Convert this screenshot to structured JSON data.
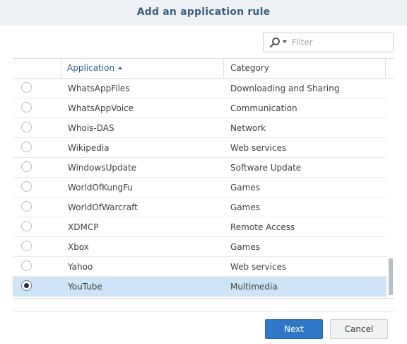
{
  "dialog": {
    "title": "Add an application rule"
  },
  "filter": {
    "placeholder": "Filter",
    "value": ""
  },
  "table": {
    "columns": {
      "application": "Application",
      "category": "Category",
      "sort_direction": "ascending"
    },
    "rows": [
      {
        "application": "WhatsAppFiles",
        "category": "Downloading and Sharing",
        "selected": false
      },
      {
        "application": "WhatsAppVoice",
        "category": "Communication",
        "selected": false
      },
      {
        "application": "Whois-DAS",
        "category": "Network",
        "selected": false
      },
      {
        "application": "Wikipedia",
        "category": "Web services",
        "selected": false
      },
      {
        "application": "WindowsUpdate",
        "category": "Software Update",
        "selected": false
      },
      {
        "application": "WorldOfKungFu",
        "category": "Games",
        "selected": false
      },
      {
        "application": "WorldOfWarcraft",
        "category": "Games",
        "selected": false
      },
      {
        "application": "XDMCP",
        "category": "Remote Access",
        "selected": false
      },
      {
        "application": "Xbox",
        "category": "Games",
        "selected": false
      },
      {
        "application": "Yahoo",
        "category": "Web services",
        "selected": false
      },
      {
        "application": "YouTube",
        "category": "Multimedia",
        "selected": true
      }
    ]
  },
  "buttons": {
    "next": "Next",
    "cancel": "Cancel"
  },
  "colors": {
    "accent": "#2f77c7",
    "selected_row": "#cfe5f7",
    "title": "#3d5f7f"
  }
}
